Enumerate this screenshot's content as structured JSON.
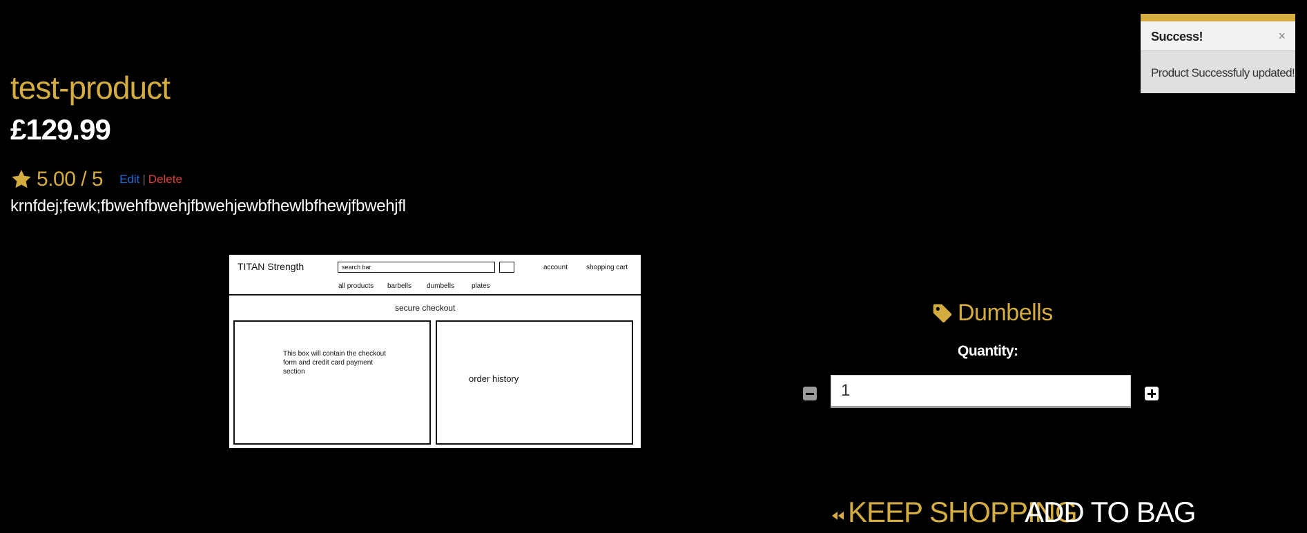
{
  "toast": {
    "title": "Success!",
    "close": "×",
    "message": "Product Successfuly updated!"
  },
  "product": {
    "name": "test-product",
    "price": "£129.99",
    "rating": "5.00 / 5",
    "edit_label": "Edit",
    "separator": "|",
    "delete_label": "Delete",
    "description": "krnfdej;fewk;fbwehfbwehjfbwehjewbfhewlbfhewjfbwehjfl",
    "category": "Dumbells"
  },
  "image": {
    "brand": "TITAN Strength",
    "search_placeholder": "search bar",
    "account": "account",
    "cart": "shopping cart",
    "nav": [
      "all products",
      "barbells",
      "dumbells",
      "plates"
    ],
    "heading": "secure checkout",
    "box1_text": "This box will contain the checkout form and credit card payment section",
    "box2_text": "order history"
  },
  "quantity": {
    "label": "Quantity:",
    "value": "1"
  },
  "actions": {
    "keep_shopping": "KEEP SHOPPING",
    "add_to_bag": "ADD TO BAG"
  },
  "colors": {
    "accent": "#d4ac3f",
    "background": "#000000",
    "edit_link": "#1e6bd6",
    "delete_link": "#d9443a"
  },
  "icons": {
    "rating": "star-icon",
    "category": "tag-icon",
    "keep_shopping": "backward-icon",
    "qty_minus": "minus-square-icon",
    "qty_plus": "plus-square-icon",
    "toast_close": "close-icon"
  }
}
